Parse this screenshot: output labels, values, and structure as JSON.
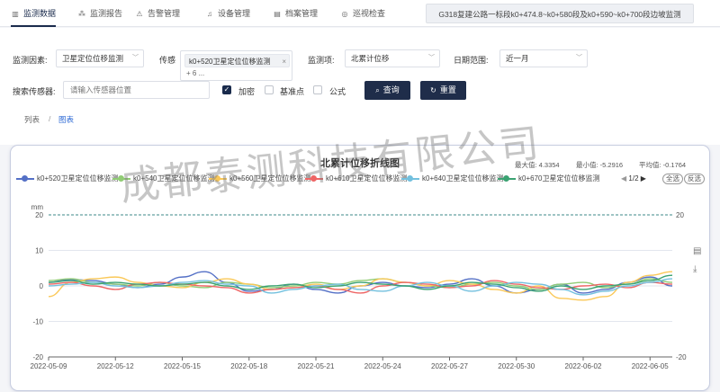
{
  "nav": {
    "tabs": [
      {
        "label": "监测数据",
        "icon": "bar-chart-icon",
        "active": true
      },
      {
        "label": "监测报告",
        "icon": "network-icon",
        "active": false
      },
      {
        "label": "告警管理",
        "icon": "warning-icon",
        "active": false
      },
      {
        "label": "设备管理",
        "icon": "bell-icon",
        "active": false
      },
      {
        "label": "档案管理",
        "icon": "document-icon",
        "active": false
      },
      {
        "label": "巡视检查",
        "icon": "gauge-icon",
        "active": false
      }
    ],
    "project": "G318复建公路一标段k0+474.8~k0+580段及k0+590~k0+700段边坡监测"
  },
  "filters": {
    "factor_label": "监测因素:",
    "factor_value": "卫星定位位移监测",
    "sensor_label": "传感器:",
    "sensor_label_visible": "传感",
    "sensor_tag": "k0+520卫星定位位移监测",
    "sensor_more": "+ 6 ...",
    "item_label": "监测项:",
    "item_value": "北累计位移",
    "date_label": "日期范围:",
    "date_value": "近一月",
    "search_label": "搜索传感器:",
    "search_placeholder": "请输入传感器位置",
    "encrypt_label": "加密",
    "benchmark_label": "基准点",
    "formula_label": "公式",
    "query_label": "查询",
    "reset_label": "重置"
  },
  "breadcrumb": {
    "list": "列表",
    "separator": "/",
    "chart": "图表"
  },
  "chart": {
    "max_text": "最大值: 4.3354",
    "min_text": "最小值: -5.2916",
    "avg_text": "平均值: -0.1764",
    "page_text": "1/2",
    "select_all": "全选",
    "invert": "反选",
    "watermark": "成都泰测科技有限公司"
  },
  "chart_data": {
    "type": "line",
    "title": "北累计位移折线图",
    "ylabel": "mm",
    "ylim": [
      -20,
      20
    ],
    "yticks": [
      20,
      10,
      0,
      -10,
      -20
    ],
    "right_axis_ticks": [
      20,
      -20
    ],
    "x_tick_labels": [
      "2022-05-09",
      "2022-05-12",
      "2022-05-15",
      "2022-05-18",
      "2022-05-21",
      "2022-05-24",
      "2022-05-27",
      "2022-05-30",
      "2022-06-02",
      "2022-06-05"
    ],
    "x_tick_days": [
      0,
      3,
      6,
      9,
      12,
      15,
      18,
      21,
      24,
      27
    ],
    "x_days": [
      0,
      1,
      2,
      3,
      4,
      5,
      6,
      7,
      8,
      9,
      10,
      11,
      12,
      13,
      14,
      15,
      16,
      17,
      18,
      19,
      20,
      21,
      22,
      23,
      24,
      25,
      26,
      27,
      28
    ],
    "series": [
      {
        "name": "k0+520卫星定位位移监测",
        "color": "#5470c6",
        "values": [
          1,
          1.8,
          1.5,
          0.5,
          -0.5,
          0.5,
          2.5,
          4,
          1,
          -1.5,
          -1,
          0.5,
          -1,
          -2,
          0,
          1,
          0,
          -0.5,
          0.5,
          2,
          0,
          -2,
          -1,
          0.5,
          -2,
          -1,
          1,
          2.5,
          0
        ]
      },
      {
        "name": "k0+540卫星定位位移监测",
        "color": "#91cc75",
        "values": [
          1.5,
          2,
          1,
          0.5,
          0,
          1,
          0,
          -0.5,
          1,
          0.5,
          -0.5,
          0,
          1,
          0.5,
          1.5,
          2,
          1,
          0,
          -0.5,
          0.5,
          1,
          0,
          -1,
          0.5,
          1,
          -0.5,
          0.5,
          2,
          1
        ]
      },
      {
        "name": "k0+560卫星定位位移监测",
        "color": "#fac858",
        "values": [
          -3,
          1,
          2,
          2.5,
          1,
          0,
          -0.5,
          1,
          2,
          0.5,
          -1,
          -0.5,
          0.5,
          -1,
          0,
          2,
          1,
          0,
          1.5,
          0.5,
          -1,
          -2,
          0,
          -3.5,
          -4,
          -3,
          1,
          3,
          4
        ]
      },
      {
        "name": "k0+610卫星定位位移监测",
        "color": "#ee6666",
        "values": [
          0.5,
          1,
          0,
          -1,
          0.5,
          1,
          0.5,
          0,
          -0.5,
          -2,
          -1,
          -0.5,
          0,
          -1,
          -2,
          0,
          1,
          0.5,
          -0.5,
          0,
          1.5,
          0.5,
          -0.5,
          -1,
          0,
          0.5,
          -0.5,
          1,
          0.5
        ]
      },
      {
        "name": "k0+640卫星定位位移监测",
        "color": "#73c0de",
        "values": [
          0,
          0.5,
          1,
          0,
          -0.5,
          0,
          1,
          1.5,
          0.5,
          0,
          -2,
          -1,
          0,
          0.5,
          -1,
          -1.5,
          0,
          1,
          0,
          -1.5,
          0,
          1,
          0.5,
          -1,
          -2.5,
          -1.5,
          0,
          1,
          2
        ]
      },
      {
        "name": "k0+670卫星定位位移监测",
        "color": "#3ba272",
        "values": [
          1,
          1.5,
          0.5,
          1,
          0.5,
          0,
          0.5,
          1,
          0,
          -1,
          0,
          0.5,
          -0.5,
          0,
          1,
          0.5,
          0,
          -1,
          0,
          1,
          0.5,
          -0.5,
          -1.5,
          0,
          -1,
          0,
          0.5,
          1.5,
          3
        ]
      }
    ]
  }
}
